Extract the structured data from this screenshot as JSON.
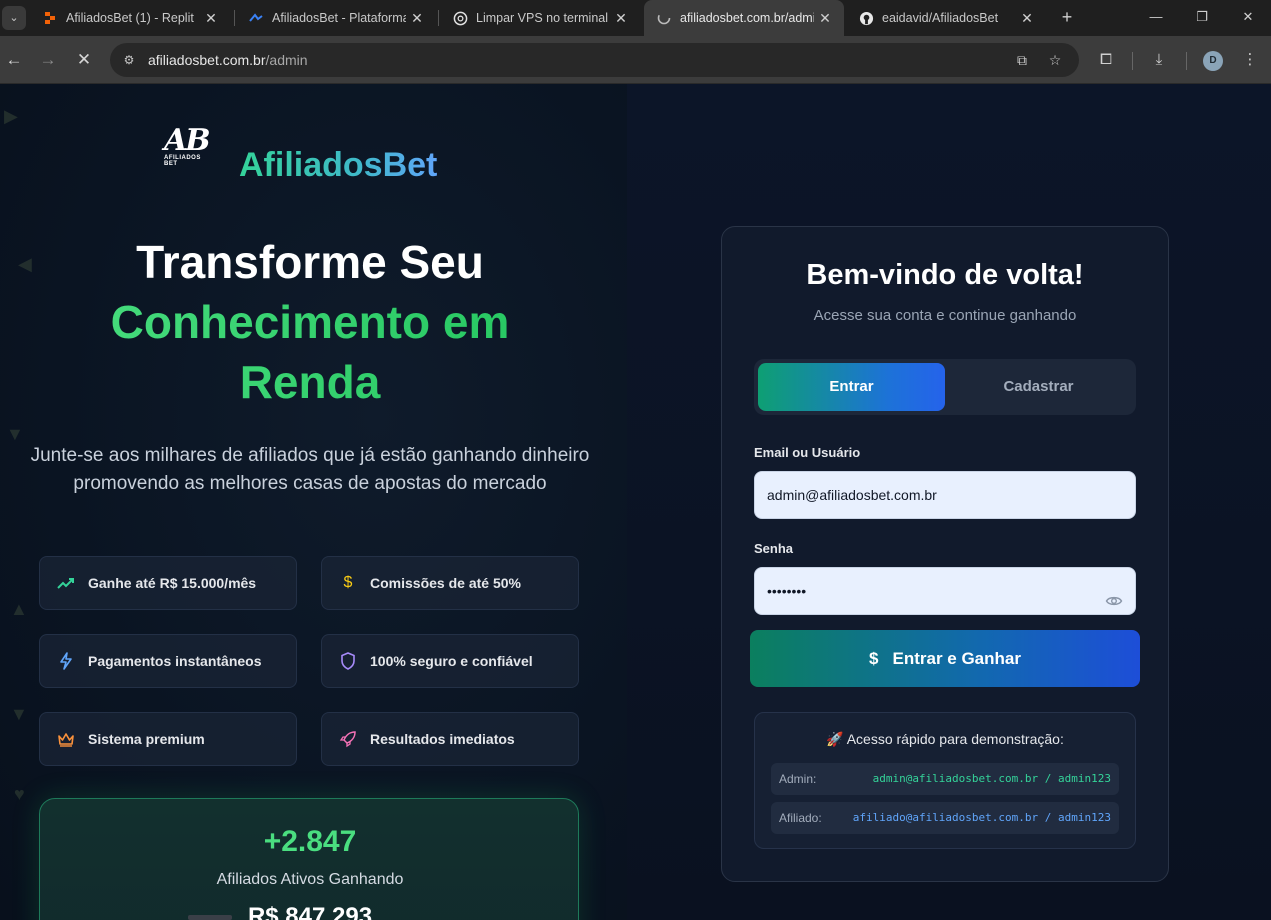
{
  "browser": {
    "tabs": [
      {
        "title": "AfiliadosBet (1) - Replit",
        "active": false
      },
      {
        "title": "AfiliadosBet - Plataforma",
        "active": false
      },
      {
        "title": "Limpar VPS no terminal",
        "active": false
      },
      {
        "title": "afiliadosbet.com.br/admi",
        "active": true
      },
      {
        "title": "eaidavid/AfiliadosBet",
        "active": false
      }
    ],
    "url_domain": "afiliadosbet.com.br",
    "url_path": "/admin",
    "profile_initial": "D"
  },
  "hero": {
    "logo_text": "AB",
    "logo_sub": "AFILIADOS BET",
    "brand": "AfiliadosBet",
    "headline_white": "Transforme Seu",
    "headline_green_1": "Conhecimento em",
    "headline_green_2": "Renda",
    "subtext": "Junte-se aos milhares de afiliados que já estão ganhando dinheiro promovendo as melhores casas de apostas do mercado"
  },
  "features": [
    {
      "label": "Ganhe até R$ 15.000/mês",
      "icon": "trending-up-icon",
      "color": "#34d399"
    },
    {
      "label": "Comissões de até 50%",
      "icon": "dollar-icon",
      "color": "#facc15"
    },
    {
      "label": "Pagamentos instantâneos",
      "icon": "lightning-icon",
      "color": "#60a5fa"
    },
    {
      "label": "100% seguro e confiável",
      "icon": "shield-icon",
      "color": "#a78bfa"
    },
    {
      "label": "Sistema premium",
      "icon": "crown-icon",
      "color": "#fb923c"
    },
    {
      "label": "Resultados imediatos",
      "icon": "rocket-icon",
      "color": "#f472b6"
    }
  ],
  "stats": {
    "affiliates_value": "+2.847",
    "affiliates_label": "Afiliados Ativos Ganhando",
    "revenue_value": "R$ 847.293"
  },
  "login": {
    "title": "Bem-vindo de volta!",
    "subtitle": "Acesse sua conta e continue ganhando",
    "tab_login": "Entrar",
    "tab_register": "Cadastrar",
    "email_label": "Email ou Usuário",
    "email_value": "admin@afiliadosbet.com.br",
    "password_label": "Senha",
    "password_value": "••••••••",
    "submit_icon": "$",
    "submit_label": "Entrar e Ganhar",
    "demo_title": "🚀 Acesso rápido para demonstração:",
    "demo_admin_key": "Admin:",
    "demo_admin_value": "admin@afiliadosbet.com.br / admin123",
    "demo_affiliate_key": "Afiliado:",
    "demo_affiliate_value": "afiliado@afiliadosbet.com.br / admin123"
  },
  "colors": {
    "accent_green": "#34d399",
    "accent_blue": "#2563eb",
    "admin_value": "#34d399",
    "affiliate_value": "#60a5fa"
  }
}
